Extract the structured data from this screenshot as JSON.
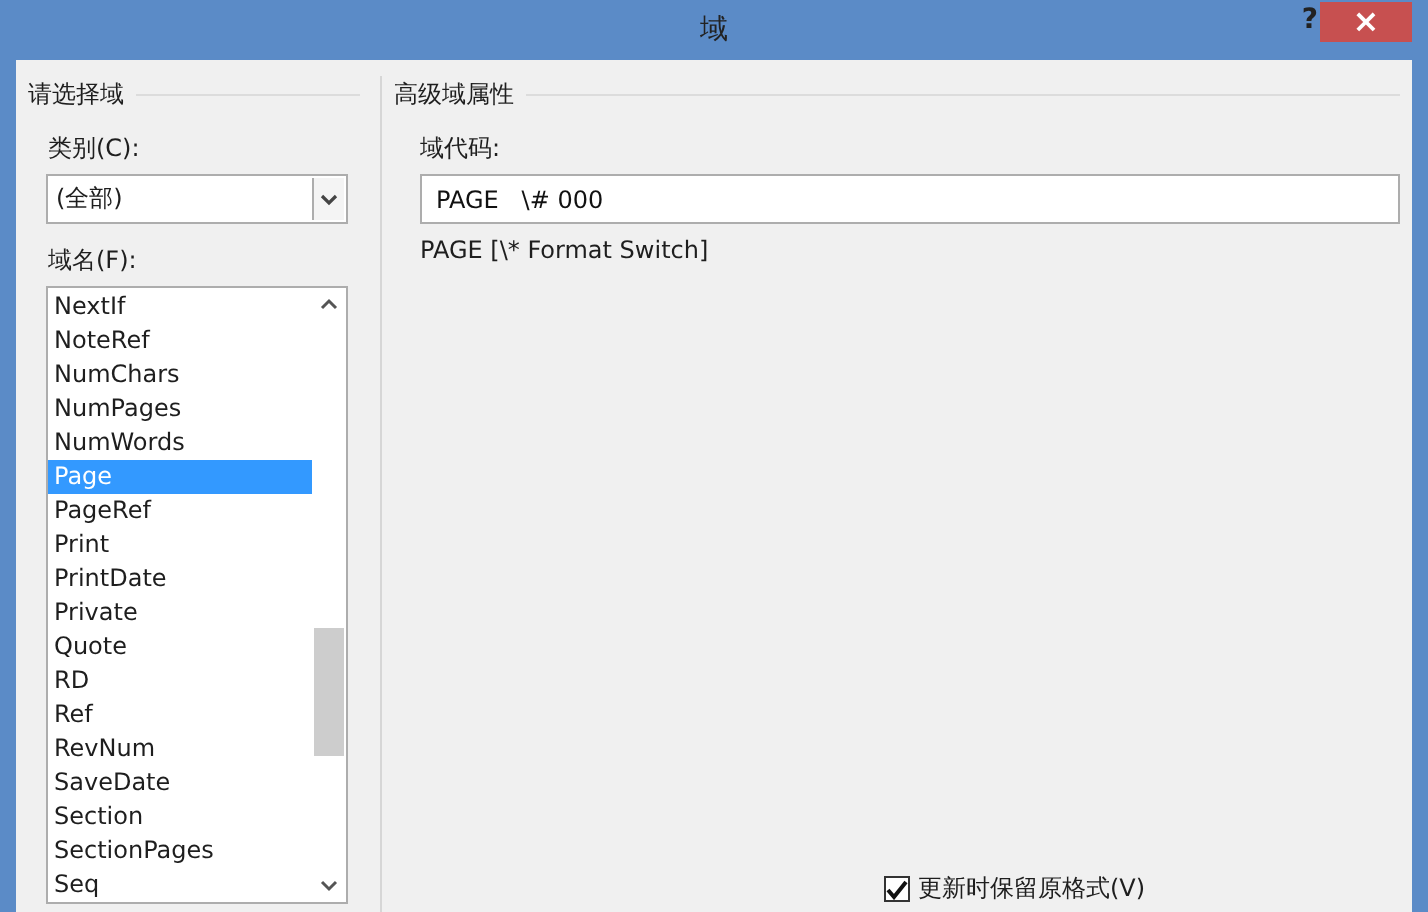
{
  "window": {
    "title": "域",
    "help": "?",
    "close": "×"
  },
  "left": {
    "heading": "请选择域",
    "category_label": "类别(C):",
    "category_value": "(全部)",
    "names_label": "域名(F):",
    "names": [
      {
        "label": "NextIf",
        "selected": false
      },
      {
        "label": "NoteRef",
        "selected": false
      },
      {
        "label": "NumChars",
        "selected": false
      },
      {
        "label": "NumPages",
        "selected": false
      },
      {
        "label": "NumWords",
        "selected": false
      },
      {
        "label": "Page",
        "selected": true
      },
      {
        "label": "PageRef",
        "selected": false
      },
      {
        "label": "Print",
        "selected": false
      },
      {
        "label": "PrintDate",
        "selected": false
      },
      {
        "label": "Private",
        "selected": false
      },
      {
        "label": "Quote",
        "selected": false
      },
      {
        "label": "RD",
        "selected": false
      },
      {
        "label": "Ref",
        "selected": false
      },
      {
        "label": "RevNum",
        "selected": false
      },
      {
        "label": "SaveDate",
        "selected": false
      },
      {
        "label": "Section",
        "selected": false
      },
      {
        "label": "SectionPages",
        "selected": false
      },
      {
        "label": "Seq",
        "selected": false
      }
    ]
  },
  "right": {
    "heading": "高级域属性",
    "code_label": "域代码:",
    "code_value": "PAGE   \\# 000",
    "syntax": "PAGE [\\* Format Switch]",
    "preserve": {
      "label": "更新时保留原格式(V)",
      "checked": true
    }
  }
}
